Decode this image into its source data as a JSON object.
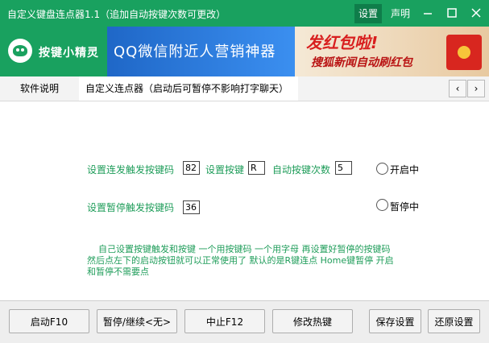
{
  "window": {
    "title": "自定义键盘连点器1.1（追加自动按键次数可更改）",
    "settings_label": "设置",
    "declare_label": "声明"
  },
  "banner": {
    "app_name": "按键小精灵",
    "ad1_text": "QQ微信附近人营销神器",
    "ad2_line1": "发红包啦!",
    "ad2_line2": "搜狐新闻自动刷红包"
  },
  "tabs": [
    {
      "label": "软件说明"
    },
    {
      "label": "自定义连点器（启动后可暂停不影响打字聊天）"
    }
  ],
  "form": {
    "trigger_key_label": "设置连发触发按键码",
    "trigger_key_value": "82",
    "set_key_label": "设置按键",
    "set_key_value": "R",
    "auto_count_label": "自动按键次数",
    "auto_count_value": "5",
    "status_on_label": "开启中",
    "pause_key_label": "设置暂停触发按键码",
    "pause_key_value": "36",
    "status_pause_label": "暂停中"
  },
  "description": [
    "    自己设置按键触发和按键 一个用按键码 一个用字母 再设置好暂停的按键码",
    "然后点左下的启动按钮就可以正常使用了 默认的是R键连点 Home键暂停 开启",
    "和暂停不需要点"
  ],
  "buttons": {
    "start": "启动F10",
    "pause": "暂停/继续<无>",
    "stop": "中止F12",
    "hotkey": "修改热键",
    "save": "保存设置",
    "restore": "还原设置"
  },
  "colors": {
    "brand_green": "#19a15f",
    "label_green": "#1f9d5a"
  }
}
